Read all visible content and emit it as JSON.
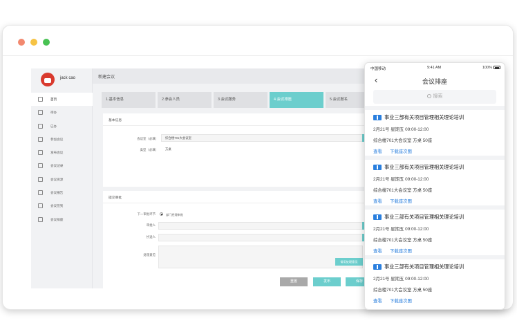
{
  "window_controls": {
    "close_color": "#f2896f",
    "minimize_color": "#f6c344",
    "maximize_color": "#48c253"
  },
  "desktop": {
    "username": "jack cao",
    "page_title": "新建会议",
    "menu": [
      {
        "label": "首页",
        "icon": "home-icon"
      },
      {
        "label": "待办",
        "icon": "inbox-icon"
      },
      {
        "label": "已办",
        "icon": "document-icon"
      },
      {
        "label": "参加会议",
        "icon": "people-icon"
      },
      {
        "label": "发布会议",
        "icon": "send-icon"
      },
      {
        "label": "会议记录",
        "icon": "record-icon"
      },
      {
        "label": "会议资源",
        "icon": "resource-icon"
      },
      {
        "label": "会议报告",
        "icon": "report-icon"
      },
      {
        "label": "会议签到",
        "icon": "checkin-icon"
      },
      {
        "label": "会议排座",
        "icon": "seat-icon"
      }
    ],
    "steps": [
      "1.基本信息",
      "2.参会人员",
      "3.会议服务",
      "4.会议排座",
      "5.会议报名"
    ],
    "active_step": 3,
    "basic": {
      "title": "基本信息",
      "room_label": "会议室（必填）",
      "room_value": "综合楼701大会议室",
      "type_label": "类型（必填）",
      "type_value": "方桌"
    },
    "submit": {
      "title": "提交审批",
      "next_label": "下一审批环节",
      "next_value": "部门经理审批",
      "approver_label": "审批人",
      "cc_label": "抄送人",
      "opinion_label": "处理意见",
      "common_opinion_btn": "常用处理意见"
    },
    "buttons": {
      "reset": "重置",
      "publish": "发布",
      "save": "保存"
    }
  },
  "mobile": {
    "carrier": "中国移动",
    "time": "9:41 AM",
    "battery": "100%",
    "title": "会议排座",
    "search_placeholder": "搜索",
    "items": [
      {
        "name": "事业三部有关项目管理相关理论培训",
        "date": "2月21号 星期五  09:00-12:00",
        "location": "综合楼701大会议室    方桌    50座",
        "view": "查看",
        "download": "下载座次图"
      },
      {
        "name": "事业三部有关项目管理相关理论培训",
        "date": "2月21号 星期五  09:00-12:00",
        "location": "综合楼701大会议室    方桌    50座",
        "view": "查看",
        "download": "下载座次图"
      },
      {
        "name": "事业三部有关项目管理相关理论培训",
        "date": "2月21号 星期五  09:00-12:00",
        "location": "综合楼701大会议室    方桌    50座",
        "view": "查看",
        "download": "下载座次图"
      },
      {
        "name": "事业三部有关项目管理相关理论培训",
        "date": "2月21号 星期五  09:00-12:00",
        "location": "综合楼701大会议室    方桌    50座",
        "view": "查看",
        "download": "下载座次图"
      }
    ],
    "accent_color": "#2a7fde"
  }
}
